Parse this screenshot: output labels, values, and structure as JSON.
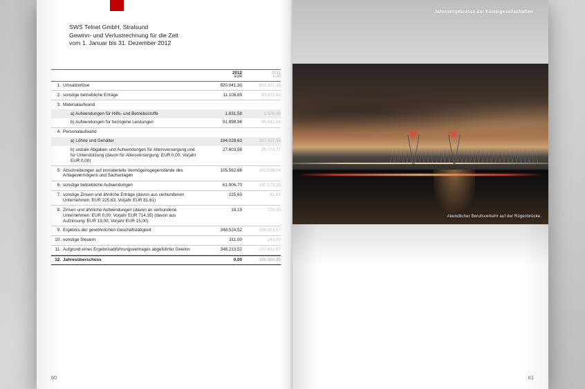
{
  "header": {
    "company": "SWS Telnet GmbH, Stralsund",
    "report": "Gewinn- und Verlustrechnung für die Zeit",
    "period": "vom 1. Januar bis 31. Dezember 2012"
  },
  "columns": {
    "y1": "2012",
    "y1u": "EUR",
    "y2": "2011",
    "y2u": "EUR"
  },
  "rows": [
    {
      "n": "1.",
      "label": "Umsatzerlöse",
      "v1": "820.041,30",
      "v2": "800.331,35",
      "b": true
    },
    {
      "n": "2.",
      "label": "sonstige betriebliche Erträge",
      "v1": "11.108,89",
      "v2": "90.972,62",
      "b": true
    },
    {
      "n": "3.",
      "label": "Materialaufwand",
      "v1": "",
      "v2": ""
    },
    {
      "n": "",
      "label": "a) Aufwendungen für Hilfs- und Betriebsstoffe",
      "v1": "1.831,58",
      "v2": "1.376,38",
      "indent": true,
      "shade": true
    },
    {
      "n": "",
      "label": "b) Aufwendungen für bezogene Leistungen",
      "v1": "91.898,96",
      "v2": "96.842,54",
      "indent": true,
      "b": true
    },
    {
      "n": "4.",
      "label": "Personalaufwand",
      "v1": "",
      "v2": ""
    },
    {
      "n": "",
      "label": "a) Löhne und Gehälter",
      "v1": "194.028,63",
      "v2": "187.417,58",
      "indent": true,
      "shade": true
    },
    {
      "n": "",
      "label": "b) soziale Abgaben und Aufwendungen für Altersversorgung und für Unterstützung (davon für Altersversorgung: EUR 0,00; Vorjahr EUR 0,00)",
      "v1": "27.603,58",
      "v2": "26.774,77",
      "indent": true,
      "b": true
    },
    {
      "n": "5.",
      "label": "Abschreibungen auf immaterielle Vermögensgegenstände des Anlagevermögens und Sachanlagen",
      "v1": "105.562,66",
      "v2": "102.598,04",
      "b": true
    },
    {
      "n": "6.",
      "label": "sonstige betriebliche Aufwendungen",
      "v1": "61.906,70",
      "v2": "137.573,35",
      "b": true
    },
    {
      "n": "7.",
      "label": "sonstige Zinsen und ähnliche Erträge (davon aus verbundenen Unternehmen: EUR 225,63; Vorjahr EUR 81,61)",
      "v1": "225,63",
      "v2": "81,61",
      "b": true
    },
    {
      "n": "8.",
      "label": "Zinsen und ähnliche Aufwendungen (davon an verbundene Unternehmen: EUR 0,00; Vorjahr EUR 714,35) (davon aus Aufzinsung: EUR 19,00; Vorjahr EUR 15,00)",
      "v1": "19,19",
      "v2": "729,35",
      "b": true
    },
    {
      "n": "9.",
      "label": "Ergebnis der gewöhnlichen Geschäftstätigkeit",
      "v1": "348.524,52",
      "v2": "338.073,57",
      "b": true
    },
    {
      "n": "10.",
      "label": "sonstige Steuern",
      "v1": "311,00",
      "v2": "241,00",
      "b": true
    },
    {
      "n": "11.",
      "label": "Aufgrund eines Ergebnisabführungsvertrages abgeführter Gewinn",
      "v1": "348.213,52",
      "v2": "237.832,57",
      "b": true
    },
    {
      "n": "12.",
      "label": "Jahresüberschuss",
      "v1": "0,00",
      "v2": "100.000,00",
      "total": true
    }
  ],
  "pageLeft": "60",
  "pageRight": "61",
  "sectionHeader": "Jahresergebnisse der Einzelgesellschaften",
  "photoCaption": "Abendlicher Berufsverkehr auf der Rügenbrücke."
}
